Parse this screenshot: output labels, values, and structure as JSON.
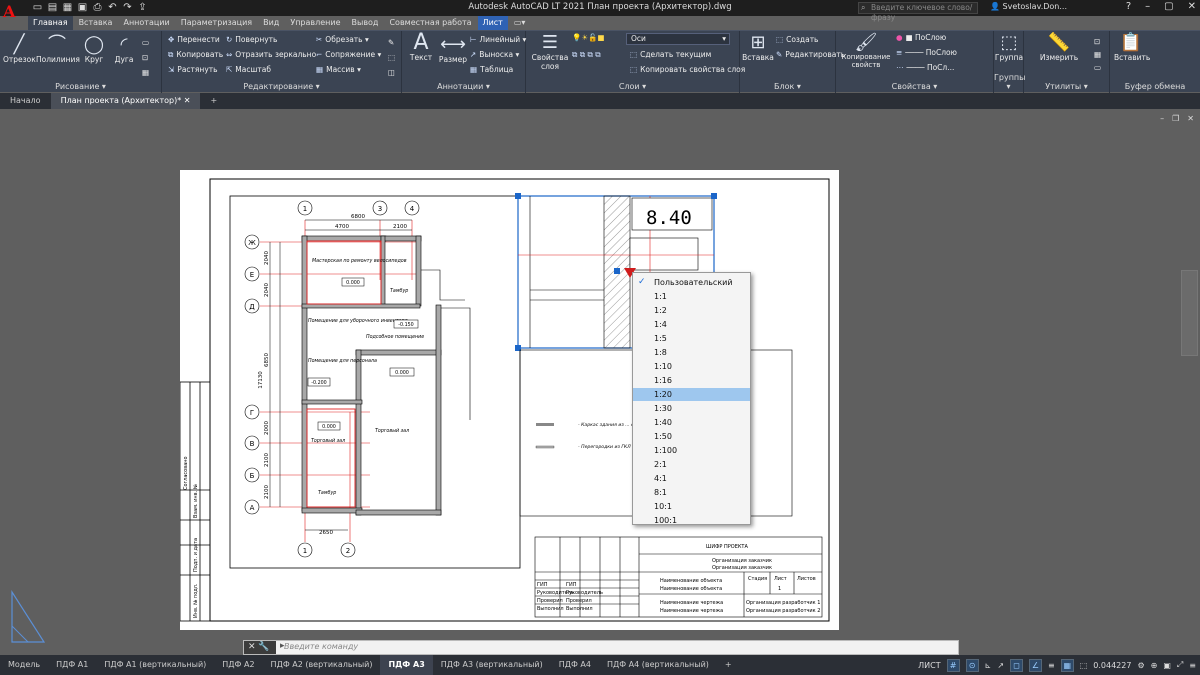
{
  "app": {
    "title": "Autodesk AutoCAD LT 2021   План проекта (Архитектор).dwg",
    "search_placeholder": "Введите ключевое слово/фразу",
    "user": "Svetoslav.Don...",
    "logo": "A"
  },
  "ribbon_tabs": [
    "Главная",
    "Вставка",
    "Аннотации",
    "Параметризация",
    "Вид",
    "Управление",
    "Вывод",
    "Совместная работа",
    "Лист"
  ],
  "panels": {
    "draw": {
      "title": "Рисование ▾",
      "buttons": [
        "Отрезок",
        "Полилиния",
        "Круг",
        "Дуга"
      ]
    },
    "modify": {
      "title": "Редактирование ▾",
      "rows": [
        "Перенести",
        "Копировать",
        "Растянуть",
        "Повернуть",
        "Отразить зеркально",
        "Масштаб",
        "Обрезать ▾",
        "Сопряжение ▾",
        "Массив ▾"
      ]
    },
    "annot": {
      "title": "Аннотации ▾",
      "buttons": [
        "Текст",
        "Размер"
      ],
      "rows": [
        "Линейный ▾",
        "Выноска ▾",
        "Таблица"
      ]
    },
    "layers": {
      "title": "Слои ▾",
      "big": "Свойства слоя",
      "current_layer": "Оси",
      "rows": [
        "Сделать текущим",
        "Копировать свойства слоя"
      ]
    },
    "block": {
      "title": "Блок ▾",
      "big": "Вставка",
      "rows": [
        "Создать",
        "Редактировать"
      ]
    },
    "props": {
      "title": "Свойства ▾",
      "big": "Копирование свойств",
      "rows": [
        "ПоСлою",
        "ПоСлою",
        "ПоСл..."
      ]
    },
    "groups": {
      "title": "Группы ▾",
      "big": "Группа"
    },
    "utils": {
      "title": "Утилиты ▾",
      "big": "Измерить"
    },
    "clip": {
      "title": "Буфер обмена",
      "big": "Вставить"
    }
  },
  "doc_tabs": [
    "Начало",
    "План проекта (Архитектор)*"
  ],
  "drawing": {
    "scale_label": "8.40",
    "dims": [
      "6800",
      "4700",
      "2100",
      "2040",
      "2040",
      "6850",
      "17130",
      "2000",
      "2100",
      "2100",
      "2650"
    ],
    "axes": [
      "1",
      "3",
      "4",
      "Ж",
      "Е",
      "Д",
      "Г",
      "В",
      "Б",
      "А",
      "1",
      "2"
    ],
    "rooms": [
      "Мастерская по ремонту велосипедов",
      "Тамбур",
      "Помещение для уборочного инвентаря",
      "Подсобное помещение",
      "Помещение для персонала",
      "Торговый зал",
      "Торговый зал",
      "Тамбур"
    ],
    "levels": [
      "0.000",
      "-0.150",
      "0.000",
      "-0.200",
      "0.000"
    ],
    "legend": [
      "- Каркас здания из ... стены, наружные из ... толщиной 150 мм",
      "- Перегородки из ГКЛ ... 100мм"
    ],
    "title_block": {
      "project": "ШИФР ПРОЕКТА",
      "org": "Организация заказчик",
      "org2": "Организация заказчик",
      "obj": "Наименование объекта",
      "drawing": "Наименование чертежа",
      "stage": "Стадия",
      "sheet": "Лист",
      "sheets": "Листов",
      "stage_val": "1",
      "dev": "Организация разработчик 1",
      "dev2": "Организация разработчик 2",
      "sig": [
        "ГИП",
        "Руководитель",
        "Проверил",
        "Выполнил"
      ],
      "sig2": [
        "ГИП",
        "Руководитель",
        "Проверил",
        "Выполнил"
      ]
    },
    "side_labels": [
      "Согласовано",
      "Взам. инв. №",
      "Подп. и дата",
      "Инв. № подл."
    ]
  },
  "scale_menu": {
    "items": [
      "Пользовательский",
      "1:1",
      "1:2",
      "1:4",
      "1:5",
      "1:8",
      "1:10",
      "1:16",
      "1:20",
      "1:30",
      "1:40",
      "1:50",
      "1:100",
      "2:1",
      "4:1",
      "8:1",
      "10:1",
      "100:1"
    ],
    "checked": "Пользовательский",
    "highlighted": "1:20"
  },
  "cmdline": {
    "placeholder": "Введите команду"
  },
  "layout_tabs": [
    "Модель",
    "ПДФ А1",
    "ПДФ А1 (вертикальный)",
    "ПДФ А2",
    "ПДФ А2 (вертикальный)",
    "ПДФ А3",
    "ПДФ А3 (вертикальный)",
    "ПДФ А4",
    "ПДФ А4 (вертикальный)",
    "+"
  ],
  "active_layout": "ПДФ А3",
  "status": {
    "mode": "ЛИСТ",
    "zoom": "0.044227"
  }
}
